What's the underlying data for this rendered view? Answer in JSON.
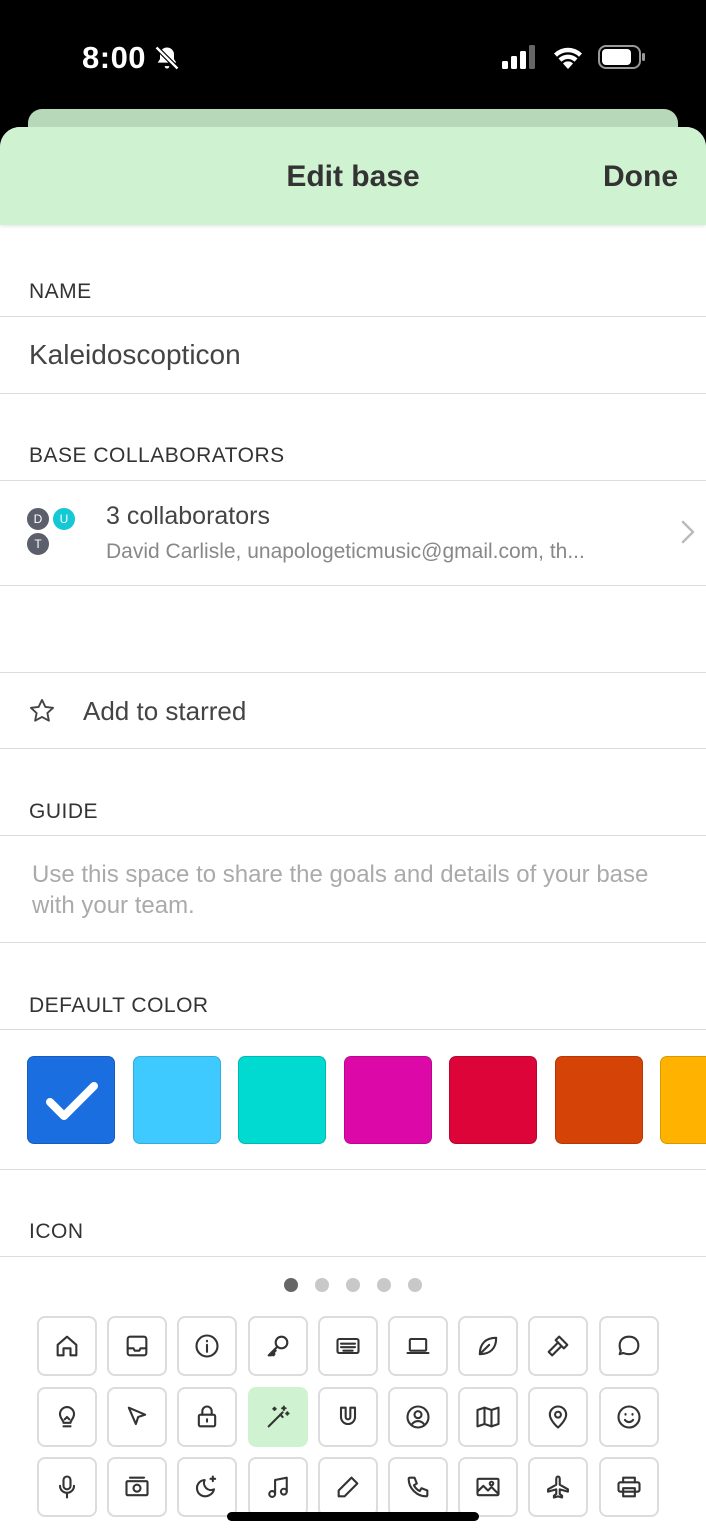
{
  "status_bar": {
    "time": "8:00"
  },
  "header": {
    "title": "Edit base",
    "done_label": "Done"
  },
  "name_section": {
    "label": "NAME",
    "value": "Kaleidoscopticon"
  },
  "collaborators_section": {
    "label": "BASE COLLABORATORS",
    "title": "3 collaborators",
    "subtitle": "David Carlisle, unapologeticmusic@gmail.com, th...",
    "avatars": [
      {
        "initial": "D",
        "color": "#5b5f6b"
      },
      {
        "initial": "U",
        "color": "#14c8d4"
      },
      {
        "initial": "T",
        "color": "#5b5f6b"
      }
    ]
  },
  "starred": {
    "label": "Add to starred"
  },
  "guide_section": {
    "label": "GUIDE",
    "placeholder": "Use this space to share the goals and details of your base with your team."
  },
  "color_section": {
    "label": "DEFAULT COLOR",
    "selected_index": 0,
    "swatches": [
      "#1a6ee0",
      "#3ec9ff",
      "#00dad0",
      "#dc08a8",
      "#dc0439",
      "#d64306",
      "#ffb300"
    ]
  },
  "icon_section": {
    "label": "ICON",
    "pages": 5,
    "current_page": 0,
    "selected_icon": "magic-wand-icon",
    "icons": [
      [
        "home-icon",
        "inbox-icon",
        "info-icon",
        "key-icon",
        "keyboard-icon",
        "laptop-icon",
        "leaf-icon",
        "gavel-icon",
        "chat-bubble-icon"
      ],
      [
        "lightbulb-icon",
        "cursor-icon",
        "lock-icon",
        "magic-wand-icon",
        "magnet-icon",
        "user-circle-icon",
        "map-icon",
        "map-pin-icon",
        "smiley-icon"
      ],
      [
        "microphone-icon",
        "money-icon",
        "moon-stars-icon",
        "music-icon",
        "pencil-icon",
        "phone-icon",
        "image-icon",
        "airplane-icon",
        "printer-icon"
      ]
    ]
  }
}
